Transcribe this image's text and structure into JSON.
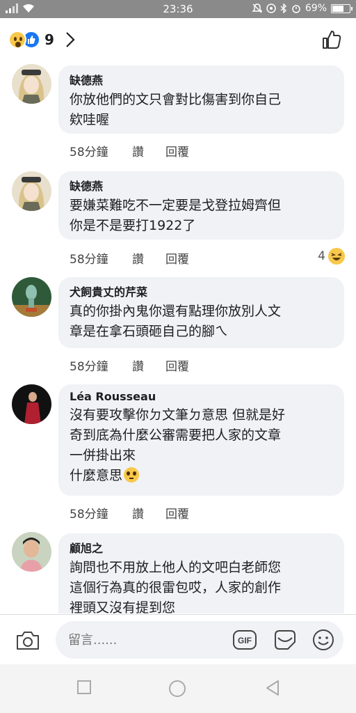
{
  "status_bar": {
    "time": "23:36",
    "battery_percent": "69%",
    "battery_level": 0.69
  },
  "header": {
    "reaction_count": "9",
    "reaction_icons": [
      "wow-emoji-icon",
      "like-icon"
    ],
    "like_icon": "thumbs-up-icon"
  },
  "comments": [
    {
      "author": "缺德燕",
      "text": "你放他們的文只會對比傷害到你自己\n欸哇喔",
      "time": "58分鐘",
      "like_label": "讚",
      "reply_label": "回覆",
      "avatar": "blonde-anime-avatar"
    },
    {
      "author": "缺德燕",
      "text": "要嫌菜難吃不一定要是戈登拉姆齊但\n你是不是要打1922了",
      "time": "58分鐘",
      "like_label": "讚",
      "reply_label": "回覆",
      "avatar": "blonde-anime-avatar",
      "reaction_count": "4",
      "reaction_icon": "laughing-emoji-icon"
    },
    {
      "author": "犬飼貴丈的芹菜",
      "text": "真的你掛內鬼你還有點理你放別人文\n章是在拿石頭砸自己的腳ㄟ",
      "time": "58分鐘",
      "like_label": "讚",
      "reply_label": "回覆",
      "avatar": "squidward-avatar"
    },
    {
      "author": "Léa Rousseau",
      "text": "沒有要攻擊你ㄉ文筆ㄉ意思 但就是好\n奇到底為什麼公審需要把人家的文章\n一併掛出來\n什麼意思",
      "text_emoji": "pleading-face-emoji",
      "time": "58分鐘",
      "like_label": "讚",
      "reply_label": "回覆",
      "avatar": "red-dress-avatar"
    },
    {
      "author": "顧旭之",
      "text": "詢問也不用放上他人的文吧白老師您\n這個行為真的很雷包哎，人家的創作\n裡頭又沒有提到您",
      "avatar": "man-photo-avatar"
    }
  ],
  "composer": {
    "placeholder": "留言......",
    "gif_label": "GIF",
    "icons": [
      "camera-icon",
      "gif-icon",
      "sticker-icon",
      "smile-icon"
    ]
  },
  "nav": {
    "icons": [
      "recent-apps-icon",
      "home-icon",
      "back-icon"
    ]
  }
}
